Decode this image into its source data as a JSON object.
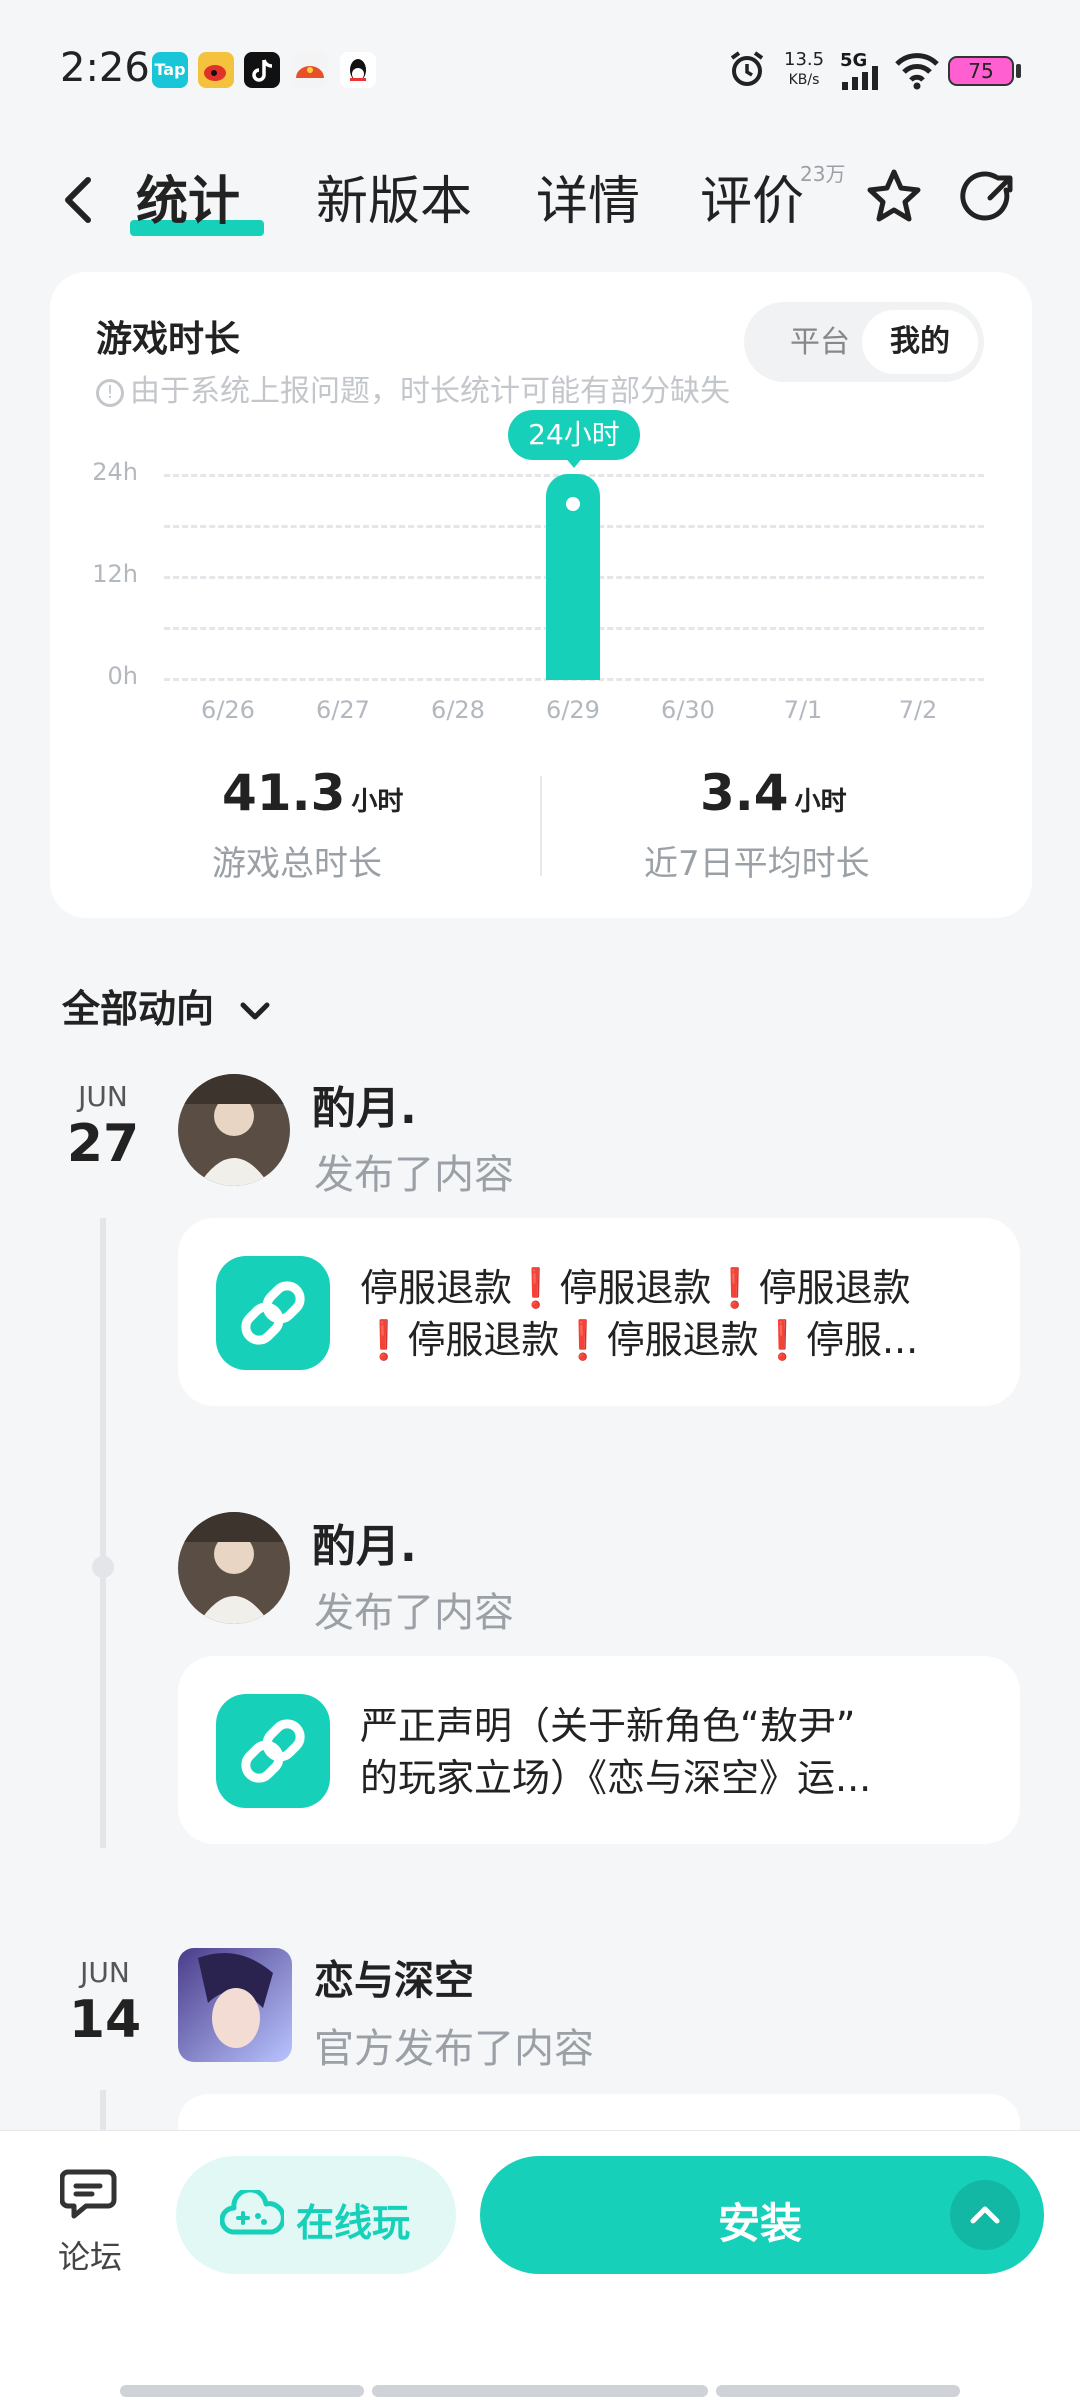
{
  "status_bar": {
    "time": "2:26",
    "speed_value": "13.5",
    "speed_unit": "KB/s",
    "network": "5G",
    "battery": "75",
    "app_icons": [
      "taptap-icon",
      "weibo-icon",
      "tiktok-icon",
      "app-icon",
      "qq-icon"
    ],
    "taptap_label": "Tap"
  },
  "nav": {
    "tabs": [
      {
        "label": "统计",
        "active": true
      },
      {
        "label": "新版本",
        "active": false
      },
      {
        "label": "详情",
        "active": false
      },
      {
        "label": "评价",
        "active": false
      }
    ],
    "review_badge": "23万"
  },
  "stats": {
    "title": "游戏时长",
    "notice": "由于系统上报问题，时长统计可能有部分缺失",
    "toggle": {
      "left": "平台",
      "right": "我的",
      "selected": "我的"
    },
    "tooltip": "24小时",
    "total_value": "41.3",
    "total_unit": "小时",
    "total_label": "游戏总时长",
    "avg_value": "3.4",
    "avg_unit": "小时",
    "avg_label": "近7日平均时长"
  },
  "chart_data": {
    "type": "bar",
    "categories": [
      "6/26",
      "6/27",
      "6/28",
      "6/29",
      "6/30",
      "7/1",
      "7/2"
    ],
    "values": [
      0,
      0,
      0,
      24,
      0,
      0,
      0
    ],
    "y_ticks": [
      "24h",
      "12h",
      "0h"
    ],
    "ylim": [
      0,
      24
    ],
    "grid": true,
    "color": "#17d0b9"
  },
  "feed": {
    "filter_label": "全部动向",
    "groups": [
      {
        "month": "JUN",
        "day": "27",
        "posts": [
          {
            "author": "酌月.",
            "action": "发布了内容",
            "line1": "停服退款❗停服退款❗停服退款",
            "line2": "❗停服退款❗停服退款❗停服..."
          },
          {
            "author": "酌月.",
            "action": "发布了内容",
            "line1": "严正声明（关于新角色“敖尹”",
            "line2": "的玩家立场）《恋与深空》运..."
          }
        ]
      },
      {
        "month": "JUN",
        "day": "14",
        "posts": [
          {
            "author": "恋与深空",
            "action": "官方发布了内容"
          }
        ]
      }
    ]
  },
  "bottom": {
    "forum_label": "论坛",
    "cloud_play_label": "在线玩",
    "install_label": "安装"
  },
  "colors": {
    "accent": "#17d0b9",
    "background": "#f5f6f8"
  }
}
